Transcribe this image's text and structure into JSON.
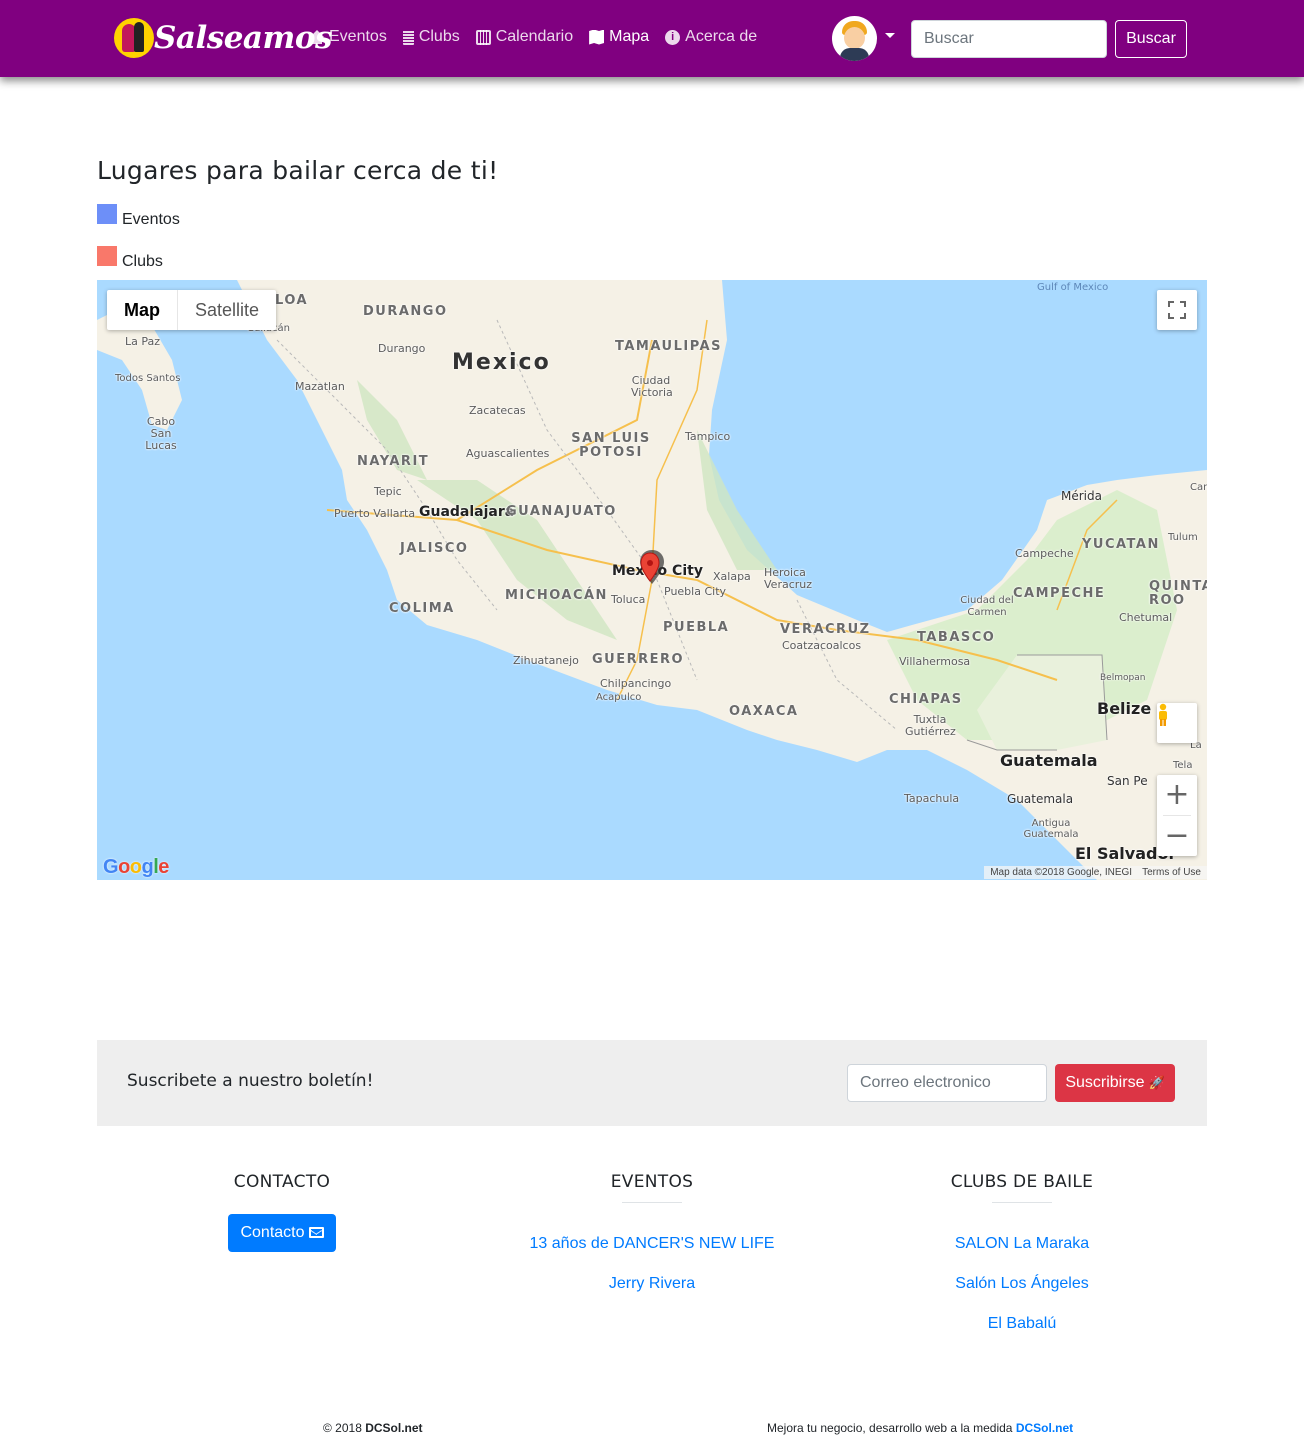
{
  "navbar": {
    "brand": "Salseamos",
    "items": [
      {
        "label": "Eventos",
        "icon": "home-icon"
      },
      {
        "label": "Clubs",
        "icon": "building-icon"
      },
      {
        "label": "Calendario",
        "icon": "calendar-icon"
      },
      {
        "label": "Mapa",
        "icon": "map-icon"
      },
      {
        "label": "Acerca de",
        "icon": "info-icon"
      }
    ],
    "active": "Mapa",
    "search_placeholder": "Buscar",
    "search_button": "Buscar",
    "bg_color": "#800080"
  },
  "main": {
    "title": "Lugares para bailar cerca de ti!",
    "legend": [
      {
        "label": "Eventos",
        "color": "#6d8ff8"
      },
      {
        "label": "Clubs",
        "color": "#f9786a"
      }
    ]
  },
  "map": {
    "type_buttons": [
      "Map",
      "Satellite"
    ],
    "selected_type": "Map",
    "labels": {
      "country_mexico": "Mexico",
      "durango_state": "DURANGO",
      "durango_city": "Durango",
      "tamaulipas": "TAMAULIPAS",
      "ciudad_victoria": "Ciudad Victoria",
      "la_paz": "La Paz",
      "todos_santos": "Todos Santos",
      "cabo_san_lucas": "Cabo San Lucas",
      "mazatlan": "Mazatlan",
      "zacatecas": "Zacatecas",
      "san_luis_potosi": "SAN LUIS POTOSI",
      "tampico": "Tampico",
      "nayarit": "NAYARIT",
      "aguascalientes": "Aguascalientes",
      "tepic": "Tepic",
      "puerto_vallarta": "Puerto Vallarta",
      "guadalajara": "Guadalajara",
      "guanajuato": "GUANAJUATO",
      "jalisco": "JALISCO",
      "mexico_city": "Mexico City",
      "xalapa": "Xalapa",
      "heroica_veracruz": "Heroica Veracruz",
      "puebla_city": "Puebla City",
      "toluca": "Toluca",
      "michoacan": "MICHOACÁN",
      "colima": "COLIMA",
      "puebla_state": "PUEBLA",
      "veracruz_state": "VERACRUZ",
      "coatzacoalcos": "Coatzacoalcos",
      "zihuatanejo": "Zihuatanejo",
      "guerrero": "GUERRERO",
      "chilpancingo": "Chilpancingo",
      "acapulco": "Acapulco",
      "oaxaca": "OAXACA",
      "tabasco": "TABASCO",
      "villahermosa": "Villahermosa",
      "chiapas": "CHIAPAS",
      "tuxtla": "Tuxtla Gutiérrez",
      "merida": "Mérida",
      "yucatan": "YUCATAN",
      "campeche_city": "Campeche",
      "campeche_state": "CAMPECHE",
      "ciudad_del_carmen": "Ciudad del Carmen",
      "quintana_roo": "QUINTA ROO",
      "chetumal": "Chetumal",
      "tulum": "Tulum",
      "belmopan": "Belmopan",
      "belize": "Belize",
      "guatemala_country": "Guatemala",
      "guatemala_city": "Guatemala",
      "antigua": "Antigua Guatemala",
      "tapachula": "Tapachula",
      "san_pedro": "San Pe",
      "el_salvador": "El Salvador",
      "gulf_of_mexico": "Gulf of Mexico",
      "culiacan": "Culiacán",
      "sinaloa": "LOA",
      "cancun_partial": "Can",
      "la_partial": "La",
      "tela_partial": "Tela"
    },
    "google_logo": "Google",
    "attribution": "Map data ©2018 Google, INEGI",
    "terms": "Terms of Use"
  },
  "newsletter": {
    "title": "Suscribete a nuestro boletín!",
    "email_placeholder": "Correo electronico",
    "button": "Suscribirse"
  },
  "footer": {
    "contact": {
      "title": "CONTACTO",
      "button": "Contacto"
    },
    "events": {
      "title": "EVENTOS",
      "items": [
        "13 años de DANCER'S NEW LIFE",
        "Jerry Rivera"
      ]
    },
    "clubs": {
      "title": "CLUBS DE BAILE",
      "items": [
        "SALON La Maraka",
        "Salón Los Ángeles",
        "El Babalú"
      ]
    },
    "copyright_prefix": "© 2018",
    "copyright_brand": "DCSol.net",
    "credit_text": "Mejora tu negocio, desarrollo web a la medida",
    "credit_link": "DCSol.net"
  }
}
